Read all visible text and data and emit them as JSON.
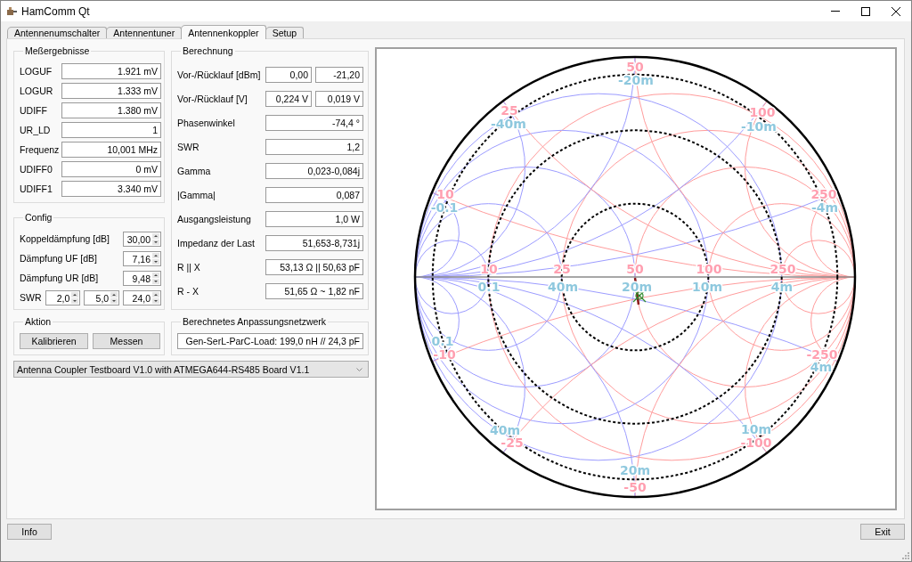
{
  "window": {
    "title": "HamComm Qt"
  },
  "tabs": [
    {
      "label": "Antennenumschalter",
      "selected": false
    },
    {
      "label": "Antennentuner",
      "selected": false
    },
    {
      "label": "Antennenkoppler",
      "selected": true
    },
    {
      "label": "Setup",
      "selected": false
    }
  ],
  "measurements": {
    "title": "Meßergebnisse",
    "rows": [
      {
        "label": "LOGUF",
        "value": "1.921 mV"
      },
      {
        "label": "LOGUR",
        "value": "1.333 mV"
      },
      {
        "label": "UDIFF",
        "value": "1.380 mV"
      },
      {
        "label": "UR_LD",
        "value": "1"
      },
      {
        "label": "Frequenz",
        "value": "10,001 MHz"
      },
      {
        "label": "UDIFF0",
        "value": "0 mV"
      },
      {
        "label": "UDIFF1",
        "value": "3.340 mV"
      }
    ]
  },
  "config": {
    "title": "Config",
    "rows": [
      {
        "label": "Koppeldämpfung [dB]",
        "values": [
          "30,00"
        ]
      },
      {
        "label": "Dämpfung UF [dB]",
        "values": [
          "7,16"
        ]
      },
      {
        "label": "Dämpfung UR [dB]",
        "values": [
          "9,48"
        ]
      },
      {
        "label": "SWR",
        "values": [
          "2,0",
          "5,0",
          "24,0"
        ]
      }
    ]
  },
  "action": {
    "title": "Aktion",
    "buttons": [
      "Kalibrieren",
      "Messen"
    ]
  },
  "calculation": {
    "title": "Berechnung",
    "rows": [
      {
        "label": "Vor-/Rücklauf [dBm]",
        "values": [
          "0,00",
          "-21,20"
        ]
      },
      {
        "label": "Vor-/Rücklauf [V]",
        "values": [
          "0,224 V",
          "0,019 V"
        ]
      },
      {
        "label": "Phasenwinkel",
        "values": [
          "-74,4 °"
        ]
      },
      {
        "label": "SWR",
        "values": [
          "1,2"
        ]
      },
      {
        "label": "Gamma",
        "values": [
          "0,023-0,084j"
        ]
      },
      {
        "label": "|Gamma|",
        "values": [
          "0,087"
        ]
      },
      {
        "label": "Ausgangsleistung",
        "values": [
          "1,0 W"
        ]
      },
      {
        "label": "Impedanz der Last",
        "values": [
          "51,653-8,731j"
        ]
      },
      {
        "label": "R || X",
        "values": [
          "53,13 Ω || 50,63 pF"
        ]
      },
      {
        "label": "R - X",
        "values": [
          "51,65 Ω ~ 1,82 nF"
        ]
      }
    ]
  },
  "matching_network": {
    "title": "Berechnetes Anpassungsnetzwerk",
    "value": "Gen-SerL-ParC-Load: 199,0 nH // 24,3 pF"
  },
  "board_select": {
    "value": "Antenna Coupler Testboard V1.0 with ATMEGA644-RS485 Board V1.1"
  },
  "smith_chart": {
    "axis_labels": [
      {
        "impedance": "10",
        "admittance": "0.1"
      },
      {
        "impedance": "25",
        "admittance": "40m"
      },
      {
        "impedance": "50",
        "admittance": "20m"
      },
      {
        "impedance": "100",
        "admittance": "10m"
      },
      {
        "impedance": "250",
        "admittance": "4m"
      }
    ],
    "upper_rim_labels": [
      {
        "impedance": "10",
        "admittance": "-0.1"
      },
      {
        "impedance": "25",
        "admittance": "-40m"
      },
      {
        "impedance": "50",
        "admittance": "-20m"
      },
      {
        "impedance": "100",
        "admittance": "-10m"
      },
      {
        "impedance": "250",
        "admittance": "-4m"
      }
    ],
    "lower_rim_labels": [
      {
        "impedance": "-10",
        "admittance": "0.1"
      },
      {
        "impedance": "-25",
        "admittance": "40m"
      },
      {
        "impedance": "-50",
        "admittance": "20m"
      },
      {
        "impedance": "-100",
        "admittance": "10m"
      },
      {
        "impedance": "-250",
        "admittance": "4m"
      }
    ]
  },
  "footer": {
    "info_button": "Info",
    "exit_button": "Exit"
  }
}
